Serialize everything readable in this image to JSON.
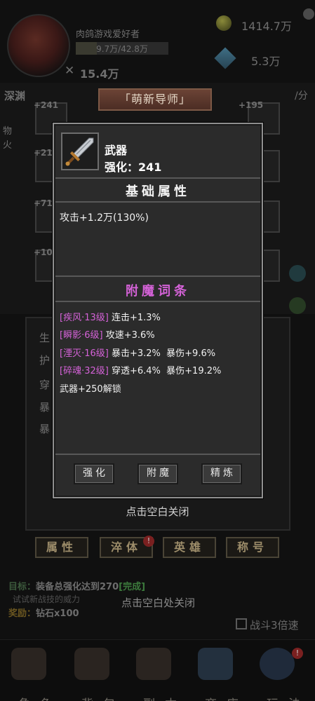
{
  "player": {
    "name": "肉鸽游戏爱好者",
    "exp": "9.7万/42.8万",
    "power": "15.4万"
  },
  "currency": {
    "coins": "1414.7万",
    "gems": "5.3万"
  },
  "bg_labels": {
    "left_header": "深渊",
    "right_header": "/分",
    "phys": "物",
    "fire": "火",
    "slot_plus_left": [
      "+241",
      "+21",
      "+71",
      "+10"
    ],
    "slot_plus_right": "+195",
    "stat_rows": [
      "生",
      "护",
      "穿",
      "暴",
      "暴"
    ]
  },
  "title_ribbon": "「萌新导师」",
  "item": {
    "name": "武器",
    "level": "强化：241"
  },
  "sections": {
    "base_title": "基础属性",
    "enchant_title": "附魔词条"
  },
  "base_attr": "攻击+1.2万(130%)",
  "enchants": [
    {
      "tag": "[疾风·13级]",
      "text": "连击+1.3%"
    },
    {
      "tag": "[瞬影·6级]",
      "text": "攻速+3.6%"
    },
    {
      "tag": "[湮灭·16级]",
      "text": "暴击+3.2%  暴伤+9.6%"
    },
    {
      "tag": "[碎魂·32级]",
      "text": "穿透+6.4%  暴伤+19.2%"
    }
  ],
  "unlock_text": "武器+250解锁",
  "popup_buttons": {
    "upgrade": "强化",
    "enchant": "附魔",
    "refine": "精炼"
  },
  "close_hint_popup": "点击空白关闭",
  "bg_tabs": [
    "属性",
    "淬体",
    "英雄",
    "称号"
  ],
  "tab_badge": "!",
  "quest": {
    "goal_label": "目标：",
    "goal_text": "装备总强化达到270",
    "goal_status": "[完成]",
    "hint": "试试新战技的威力",
    "reward_label": "奖励：",
    "reward_text": "钻石x100"
  },
  "close_hint_bg": "点击空白处关闭",
  "battle_speed": "战斗3倍速",
  "bottom_nav": [
    "角色",
    "背包",
    "副本",
    "商店",
    "玩法"
  ],
  "colors": {
    "enchant_title": "#d462d7",
    "enchant_tag": "#d462d7",
    "base_title": "#f2f2f2",
    "quest_green": "#3c7a3c"
  }
}
